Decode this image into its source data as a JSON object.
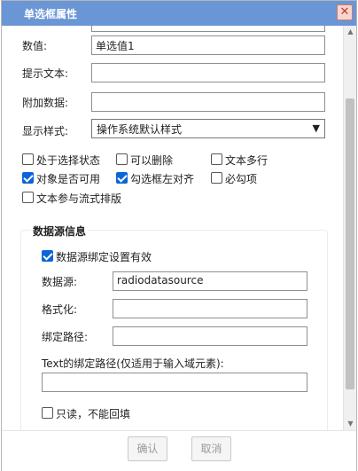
{
  "window": {
    "title": "单选框属性",
    "close_glyph": "✕"
  },
  "form": {
    "value_label": "数值:",
    "value": "单选值1",
    "hint_label": "提示文本:",
    "hint_value": "",
    "extra_label": "附加数据:",
    "extra_value": "",
    "style_label": "显示样式:",
    "style_value": "操作系统默认样式"
  },
  "options": [
    {
      "label": "处于选择状态",
      "checked": false
    },
    {
      "label": "可以删除",
      "checked": false
    },
    {
      "label": "文本多行",
      "checked": false
    },
    {
      "label": "对象是否可用",
      "checked": true
    },
    {
      "label": "勾选框左对齐",
      "checked": true
    },
    {
      "label": "必勾项",
      "checked": false
    },
    {
      "label": "文本参与流式排版",
      "checked": false
    }
  ],
  "datasource": {
    "title": "数据源信息",
    "binding_label": "数据源绑定设置有效",
    "binding_checked": true,
    "source_label": "数据源:",
    "source_value": "radiodatasource",
    "format_label": "格式化:",
    "format_value": "",
    "path_label": "绑定路径:",
    "path_value": "",
    "text_path_label": "Text的绑定路径(仅适用于输入域元素):",
    "text_path_value": "",
    "readonly_label": "只读，不能回填",
    "readonly_checked": false
  },
  "buttons": {
    "ok": "确认",
    "cancel": "取消"
  },
  "colors": {
    "titlebar": "#6a96d6",
    "checked": "#0b65d8"
  }
}
